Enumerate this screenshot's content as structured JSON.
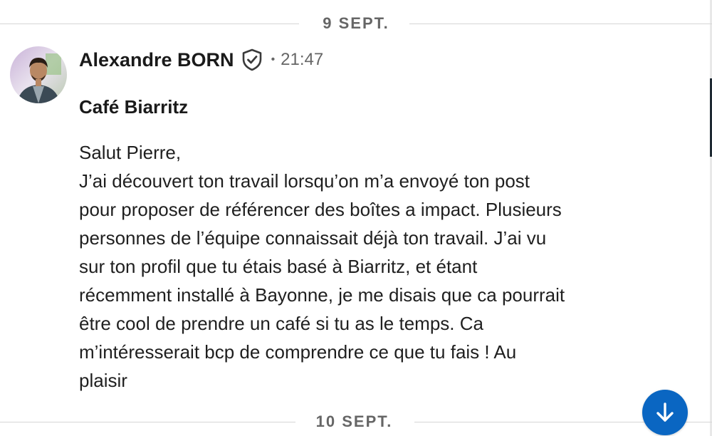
{
  "dividers": {
    "top_date": "9 SEPT.",
    "bottom_date": "10 SEPT."
  },
  "message": {
    "sender_name": "Alexandre BORN",
    "verified_icon": "shield-check-icon",
    "separator": "•",
    "time": "21:47",
    "subject": "Café Biarritz",
    "body_lines": [
      "Salut Pierre,",
      "J’ai découvert ton travail lorsqu’on m’a envoyé ton post",
      "pour proposer de référencer des boîtes a impact. Plusieurs",
      "personnes de l’équipe connaissait déjà ton travail. J’ai vu",
      "sur ton profil que tu étais basé à Biarritz, et étant",
      "récemment installé à Bayonne, je me disais que ca pourrait",
      "être cool de prendre un café si tu as le temps. Ca",
      "m’intéresserait bcp de comprendre ce que tu fais ! Au",
      "plaisir"
    ]
  },
  "jump_button": {
    "icon": "arrow-down-icon"
  },
  "colors": {
    "accent": "#0a66c2",
    "text": "#1a1a1a",
    "muted": "#666666",
    "divider": "#d6d6d6"
  }
}
